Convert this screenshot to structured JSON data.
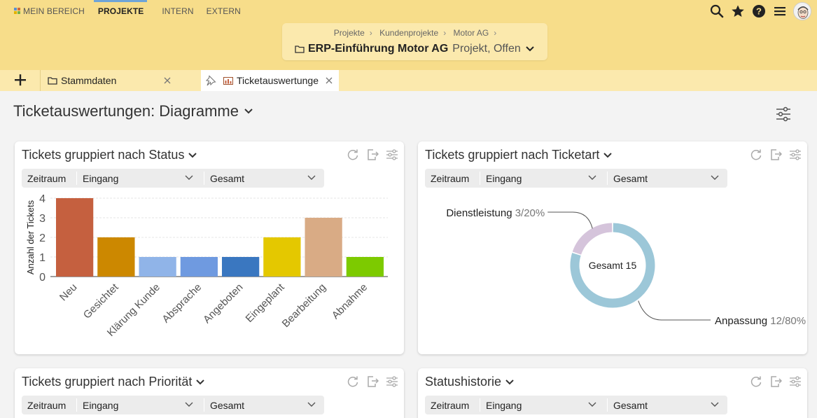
{
  "nav": {
    "items": [
      {
        "label": "MEIN BEREICH",
        "active": false
      },
      {
        "label": "PROJEKTE",
        "active": true
      },
      {
        "label": "INTERN",
        "active": false
      },
      {
        "label": "EXTERN",
        "active": false
      }
    ]
  },
  "header_icons": [
    "search-icon",
    "star-icon",
    "help-icon",
    "menu-icon",
    "avatar"
  ],
  "breadcrumb": {
    "items": [
      "Projekte",
      "Kundenprojekte",
      "Motor AG"
    ],
    "separator": "›"
  },
  "project": {
    "name": "ERP-Einführung Motor AG",
    "status": "Projekt, Offen"
  },
  "tabs": [
    {
      "label": "Stammdaten",
      "active": false
    },
    {
      "label": "Ticketauswertunge",
      "active": true
    }
  ],
  "page": {
    "title": "Ticketauswertungen: Diagramme"
  },
  "cards": [
    {
      "title": "Tickets gruppiert nach Status",
      "filter": {
        "range": "Zeitraum",
        "field": "Eingang",
        "scope": "Gesamt"
      }
    },
    {
      "title": "Tickets gruppiert nach Ticketart",
      "filter": {
        "range": "Zeitraum",
        "field": "Eingang",
        "scope": "Gesamt"
      }
    },
    {
      "title": "Tickets gruppiert nach Priorität",
      "filter": {
        "range": "Zeitraum",
        "field": "Eingang",
        "scope": "Gesamt"
      }
    },
    {
      "title": "Statushistorie",
      "filter": {
        "range": "Zeitraum",
        "field": "Eingang",
        "scope": "Gesamt"
      }
    }
  ],
  "chart_data": [
    {
      "type": "bar",
      "categories": [
        "Neu",
        "Gesichtet",
        "Klärung Kunde",
        "Absprache",
        "Angeboten",
        "Eingeplant",
        "Bearbeitung",
        "Abnahme"
      ],
      "values": [
        4,
        2,
        1,
        1,
        1,
        2,
        3,
        1
      ],
      "colors": [
        "#c5603f",
        "#cc8800",
        "#90b4e8",
        "#6f9ae0",
        "#3a77c0",
        "#e4c800",
        "#d9ab85",
        "#7dca00"
      ],
      "ylabel": "Anzahl der Tickets",
      "yticks": [
        "0",
        "1",
        "2",
        "3",
        "4"
      ],
      "ylim": [
        0,
        4
      ],
      "grid": true
    },
    {
      "type": "pie",
      "center_label": "Gesamt 15",
      "slices": [
        {
          "name": "Dienstleistung",
          "value": 3,
          "value_label": "3/20%",
          "color": "#d5c4db"
        },
        {
          "name": "Anpassung",
          "value": 12,
          "value_label": "12/80%",
          "color": "#9cc7d8"
        }
      ]
    }
  ]
}
